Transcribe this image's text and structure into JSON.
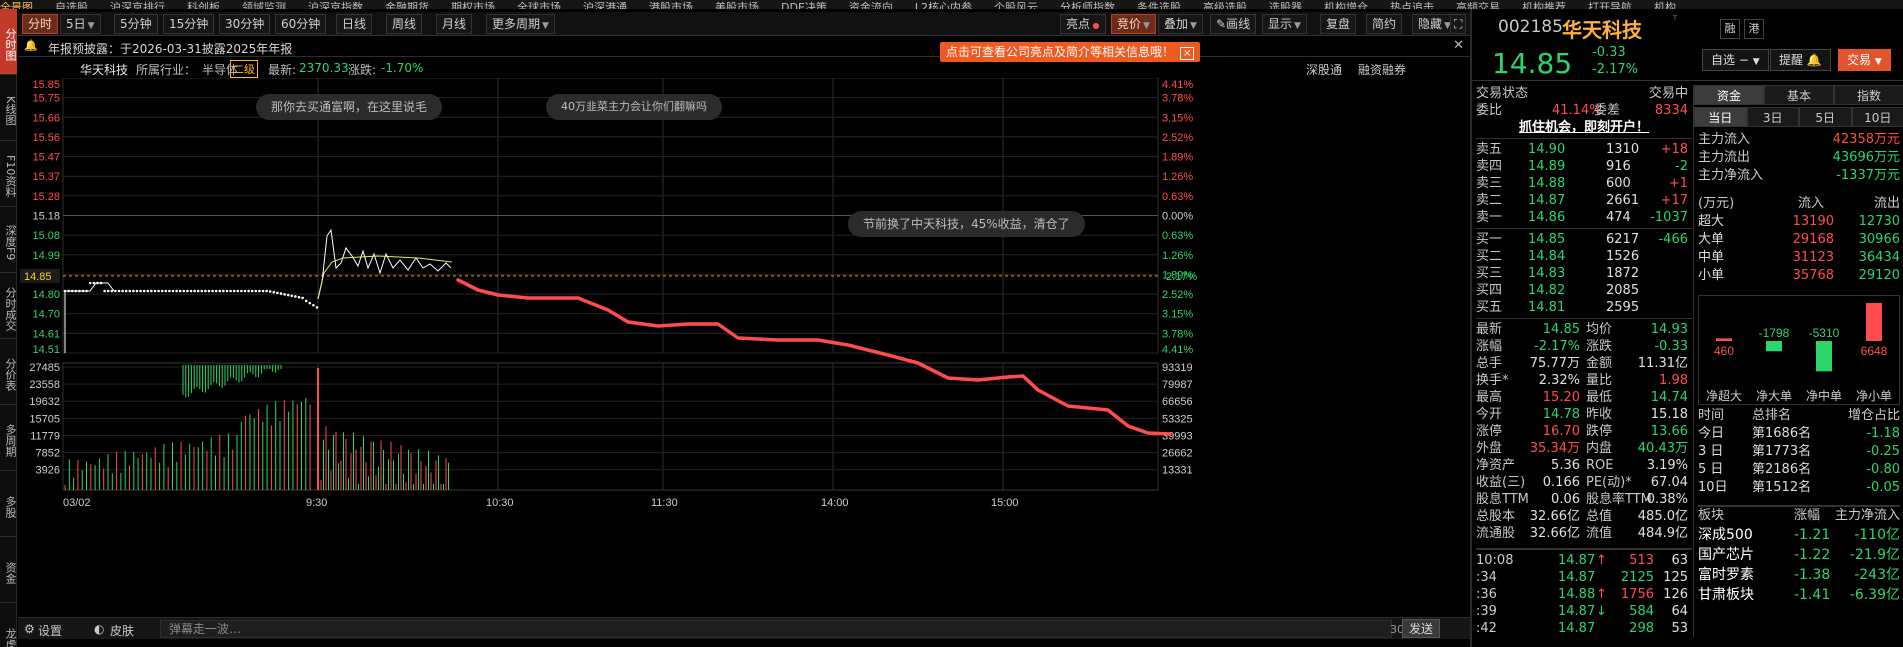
{
  "top_menu": [
    "全景图",
    "自选股",
    "沪深京排行",
    "科创板",
    "领域监测",
    "沪深京指数",
    "金融期货",
    "期权市场",
    "全球市场",
    "沪深港通",
    "港股市场",
    "美股市场",
    "DDE决策",
    "资金流向",
    "L2核心内参",
    "个股风云",
    "分析师指数",
    "条件选股",
    "高级选股",
    "选股器",
    "机构增仓",
    "热点追击",
    "高频交易",
    "机构推荐",
    "打开导航",
    "机构"
  ],
  "left_nav": [
    "分时图",
    "K线图",
    "F10资料",
    "深度F9",
    "分时成交",
    "分价表",
    "多周期",
    "多股",
    "资金",
    "龙虎"
  ],
  "toolbar": {
    "left": [
      "分时",
      "5日",
      "5分钟",
      "15分钟",
      "30分钟",
      "60分钟",
      "日线",
      "周线",
      "月线",
      "更多周期"
    ],
    "right": [
      "亮点",
      "竞价",
      "叠加",
      "画线",
      "显示",
      "复盘",
      "简约",
      "隐藏"
    ]
  },
  "notice": {
    "text": "年报预披露：于2026-03-31披露2025年年报"
  },
  "tip": {
    "text": "点击可查看公司亮点及简介等相关信息哦！",
    "close": "×"
  },
  "info_bar": {
    "name": "华天科技",
    "industry_label": "所属行业：",
    "industry": "半导体",
    "level": "二级",
    "latest_label": "最新:",
    "latest": "2370.33",
    "change_label": "涨跌:",
    "change": "-1.70%",
    "tag1": "深股通",
    "tag2": "融资融券"
  },
  "chart": {
    "price_ticks": [
      "15.85",
      "15.75",
      "15.66",
      "15.56",
      "15.47",
      "15.37",
      "15.28",
      "15.18",
      "15.08",
      "14.99",
      "14.89",
      "14.80",
      "14.70",
      "14.61",
      "14.51"
    ],
    "pct_ticks": [
      "4.41%",
      "3.78%",
      "3.15%",
      "2.52%",
      "1.89%",
      "1.26%",
      "0.63%",
      "0.00%",
      "0.63%",
      "1.26%",
      "1.89%",
      "2.52%",
      "3.15%",
      "3.78%",
      "4.41%"
    ],
    "price_label": "14.85",
    "pct_label": "2.17%",
    "vol_left": [
      "27485",
      "23558",
      "19632",
      "15705",
      "11779",
      "7852",
      "3926"
    ],
    "vol_right": [
      "93319",
      "79987",
      "66656",
      "53325",
      "39993",
      "26662",
      "13331"
    ],
    "x_labels": [
      "03/02",
      "9:30",
      "10:30",
      "11:30",
      "14:00",
      "15:00"
    ],
    "bubbles": [
      "那你去买通富啊，在这里说毛",
      "40万韭菜主力会让你们翻嘛吗",
      "节前换了中天科技，45%收益，清仓了"
    ]
  },
  "bottom_bar": {
    "settings": "设置",
    "skin": "皮肤",
    "placeholder": "弹幕走一波…",
    "count": "30",
    "send": "发送"
  },
  "quote": {
    "code": "002185",
    "name": "华天科技",
    "price": "14.85",
    "change": "-0.33",
    "pct": "-2.17%",
    "btn_zx": "自选",
    "btn_tx": "提醒",
    "btn_trade": "交易",
    "rz": "融",
    "gang": "港",
    "status_label": "交易状态",
    "status": "交易中",
    "wb_label": "委比",
    "wb": "41.14%",
    "wc_label": "委差",
    "wc": "8334",
    "promo": "抓住机会，即刻开户！",
    "sell": [
      {
        "l": "卖五",
        "p": "14.90",
        "v": "1310",
        "c": "+18"
      },
      {
        "l": "卖四",
        "p": "14.89",
        "v": "916",
        "c": "-2"
      },
      {
        "l": "卖三",
        "p": "14.88",
        "v": "600",
        "c": "+1"
      },
      {
        "l": "卖二",
        "p": "14.87",
        "v": "2661",
        "c": "+17"
      },
      {
        "l": "卖一",
        "p": "14.86",
        "v": "474",
        "c": "-1037"
      }
    ],
    "buy": [
      {
        "l": "买一",
        "p": "14.85",
        "v": "6217",
        "c": "-466"
      },
      {
        "l": "买二",
        "p": "14.84",
        "v": "1526",
        "c": ""
      },
      {
        "l": "买三",
        "p": "14.83",
        "v": "1872",
        "c": ""
      },
      {
        "l": "买四",
        "p": "14.82",
        "v": "2085",
        "c": ""
      },
      {
        "l": "买五",
        "p": "14.81",
        "v": "2595",
        "c": ""
      }
    ],
    "stats": [
      {
        "a": "最新",
        "av": "14.85",
        "b": "均价",
        "bv": "14.93"
      },
      {
        "a": "涨幅",
        "av": "-2.17%",
        "b": "涨跌",
        "bv": "-0.33"
      },
      {
        "a": "总手",
        "av": "75.77万",
        "b": "金额",
        "bv": "11.31亿"
      },
      {
        "a": "换手*",
        "av": "2.32%",
        "b": "量比",
        "bv": "1.98"
      },
      {
        "a": "最高",
        "av": "15.20",
        "b": "最低",
        "bv": "14.74"
      },
      {
        "a": "今开",
        "av": "14.78",
        "b": "昨收",
        "bv": "15.18"
      },
      {
        "a": "涨停",
        "av": "16.70",
        "b": "跌停",
        "bv": "13.66"
      },
      {
        "a": "外盘",
        "av": "35.34万",
        "b": "内盘",
        "bv": "40.43万"
      },
      {
        "a": "净资产",
        "av": "5.36",
        "b": "ROE",
        "bv": "3.19%"
      },
      {
        "a": "收益(三)",
        "av": "0.166",
        "b": "PE(动)*",
        "bv": "67.04"
      },
      {
        "a": "股息TTM",
        "av": "0.06",
        "b": "股息率TTM",
        "bv": "0.38%"
      },
      {
        "a": "总股本",
        "av": "32.66亿",
        "b": "总值",
        "bv": "485.0亿"
      },
      {
        "a": "流通股",
        "av": "32.66亿",
        "b": "流值",
        "bv": "484.9亿"
      }
    ],
    "ticks": [
      {
        "t": "10:08",
        "p": "14.87",
        "d": "↑",
        "v": "513",
        "n": "63"
      },
      {
        "t": ":34",
        "p": "14.87",
        "d": "",
        "v": "2125",
        "n": "125"
      },
      {
        "t": ":36",
        "p": "14.88",
        "d": "↑",
        "v": "1756",
        "n": "126"
      },
      {
        "t": ":39",
        "p": "14.87",
        "d": "↓",
        "v": "584",
        "n": "64"
      },
      {
        "t": ":42",
        "p": "14.87",
        "d": "",
        "v": "298",
        "n": "53"
      }
    ]
  },
  "funds": {
    "tabs": [
      "资金",
      "基本",
      "指数"
    ],
    "days": [
      "当日",
      "3日",
      "5日",
      "10日"
    ],
    "flows": [
      {
        "l": "主力流入",
        "v": "42358万元"
      },
      {
        "l": "主力流出",
        "v": "43696万元"
      },
      {
        "l": "主力净流入",
        "v": "-1337万元"
      }
    ],
    "unit": "(万元)",
    "in_label": "流入",
    "out_label": "流出",
    "orders": [
      {
        "l": "超大",
        "i": "13190",
        "o": "12730"
      },
      {
        "l": "大单",
        "i": "29168",
        "o": "30966"
      },
      {
        "l": "中单",
        "i": "31123",
        "o": "36434"
      },
      {
        "l": "小单",
        "i": "35768",
        "o": "29120"
      }
    ],
    "net_values": [
      460,
      -1798,
      -5310,
      6648
    ],
    "net_labels": [
      "净超大",
      "净大单",
      "净中单",
      "净小单"
    ],
    "rank_head": [
      "时间",
      "总排名",
      "增仓占比"
    ],
    "ranks": [
      {
        "t": "今日",
        "r": "第1686名",
        "v": "-1.18"
      },
      {
        "t": "3 日",
        "r": "第1773名",
        "v": "-0.25"
      },
      {
        "t": "5 日",
        "r": "第2186名",
        "v": "-0.80"
      },
      {
        "t": "10日",
        "r": "第1512名",
        "v": "-0.05"
      }
    ],
    "sector_head": [
      "板块",
      "涨幅",
      "主力净流入"
    ],
    "sectors": [
      {
        "n": "深成500",
        "p": "-1.21",
        "f": "-110亿"
      },
      {
        "n": "国产芯片",
        "p": "-1.22",
        "f": "-21.9亿"
      },
      {
        "n": "富时罗素",
        "p": "-1.38",
        "f": "-243亿"
      },
      {
        "n": "甘肃板块",
        "p": "-1.41",
        "f": "-6.39亿"
      }
    ]
  },
  "colors": {
    "up": "#ff4d4d",
    "down": "#2bd66a",
    "gold": "#ffb23a",
    "price_line": "#ffffff",
    "avg_line": "#e8e86b",
    "forecast_line": "#ff4d4d"
  }
}
